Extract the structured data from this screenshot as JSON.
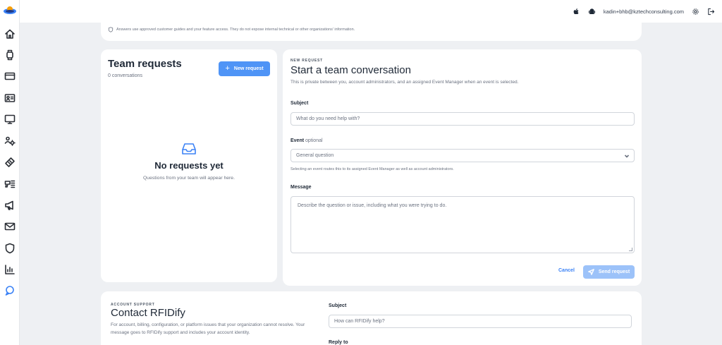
{
  "topbar": {
    "email": "kadin+bhb@kztechconsulting.com"
  },
  "notice": {
    "text": "Answers use approved customer guides and your feature access. They do not expose internal technical or other organizations' information."
  },
  "team_requests": {
    "title": "Team requests",
    "count": "0 conversations",
    "new_button": "New request",
    "empty_title": "No requests yet",
    "empty_sub": "Questions from your team will appear here."
  },
  "new_request": {
    "eyebrow": "NEW REQUEST",
    "title": "Start a team conversation",
    "description": "This is private between you, account administrators, and an assigned Event Manager when an event is selected.",
    "subject_label": "Subject",
    "subject_placeholder": "What do you need help with?",
    "event_label": "Event",
    "event_optional": "optional",
    "event_value": "General question",
    "event_help": "Selecting an event routes this to its assigned Event Manager as well as account administrators.",
    "message_label": "Message",
    "message_placeholder": "Describe the question or issue, including what you were trying to do.",
    "cancel": "Cancel",
    "send": "Send request"
  },
  "account_support": {
    "eyebrow": "ACCOUNT SUPPORT",
    "title": "Contact RFIDify",
    "description": "For account, billing, configuration, or platform issues that your organization cannot resolve. Your message goes to RFIDify support and includes your account identity.",
    "subject_label": "Subject",
    "subject_placeholder": "How can RFIDify help?",
    "reply_label": "Reply to"
  },
  "colors": {
    "accent": "#3b82f6",
    "button": "#4f94f6",
    "button_disabled": "#9cc2f9",
    "background": "#eef0f3"
  }
}
